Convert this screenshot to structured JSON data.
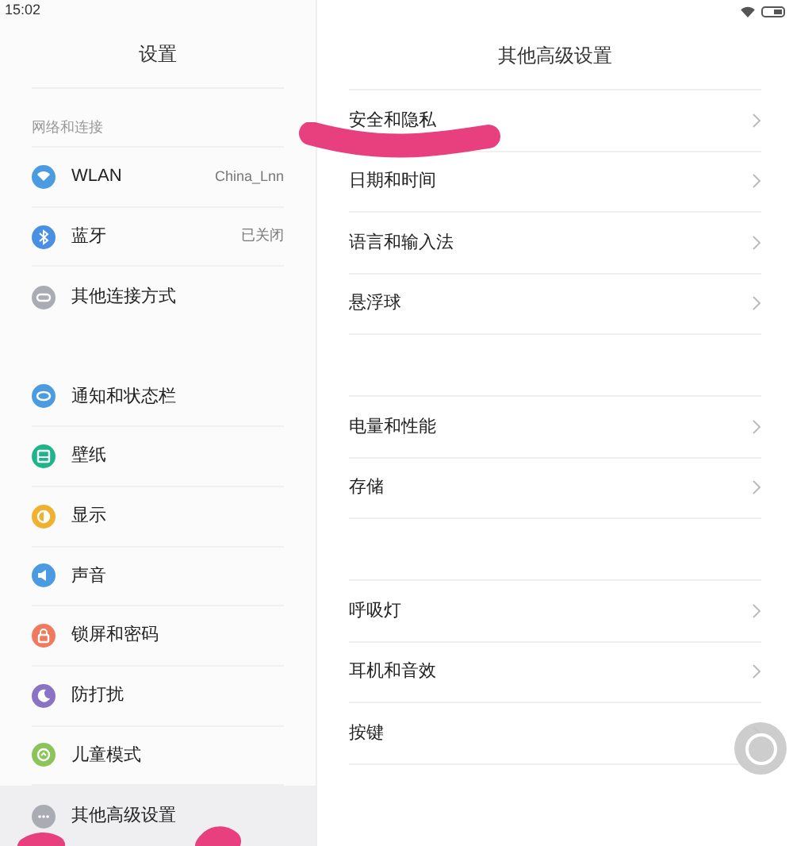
{
  "status_bar": {
    "time": "15:02"
  },
  "left": {
    "title": "设置",
    "section": "网络和连接",
    "groups": [
      [
        {
          "label": "WLAN",
          "value": "China_Lnn",
          "color": "#4a9be0",
          "selected": false
        },
        {
          "label": "蓝牙",
          "value": "已关闭",
          "color": "#4a90e2",
          "selected": false
        },
        {
          "label": "其他连接方式",
          "color": "#a9adb3",
          "selected": false
        }
      ],
      [
        {
          "label": "通知和状态栏",
          "color": "#4a9be0",
          "selected": false
        },
        {
          "label": "壁纸",
          "color": "#1fb58a",
          "selected": false
        },
        {
          "label": "显示",
          "color": "#f0b030",
          "selected": false
        },
        {
          "label": "声音",
          "color": "#4a9be0",
          "selected": false
        },
        {
          "label": "锁屏和密码",
          "color": "#ef7a5e",
          "selected": false
        },
        {
          "label": "防打扰",
          "color": "#8a73c4",
          "selected": false
        },
        {
          "label": "儿童模式",
          "color": "#8cc45a",
          "selected": false
        },
        {
          "label": "其他高级设置",
          "color": "#a9adb3",
          "selected": true
        }
      ]
    ]
  },
  "right": {
    "title": "其他高级设置",
    "groups": [
      [
        "安全和隐私",
        "日期和时间",
        "语言和输入法",
        "悬浮球"
      ],
      [
        "电量和性能",
        "存储"
      ],
      [
        "呼吸灯",
        "耳机和音效",
        "按键"
      ]
    ]
  }
}
